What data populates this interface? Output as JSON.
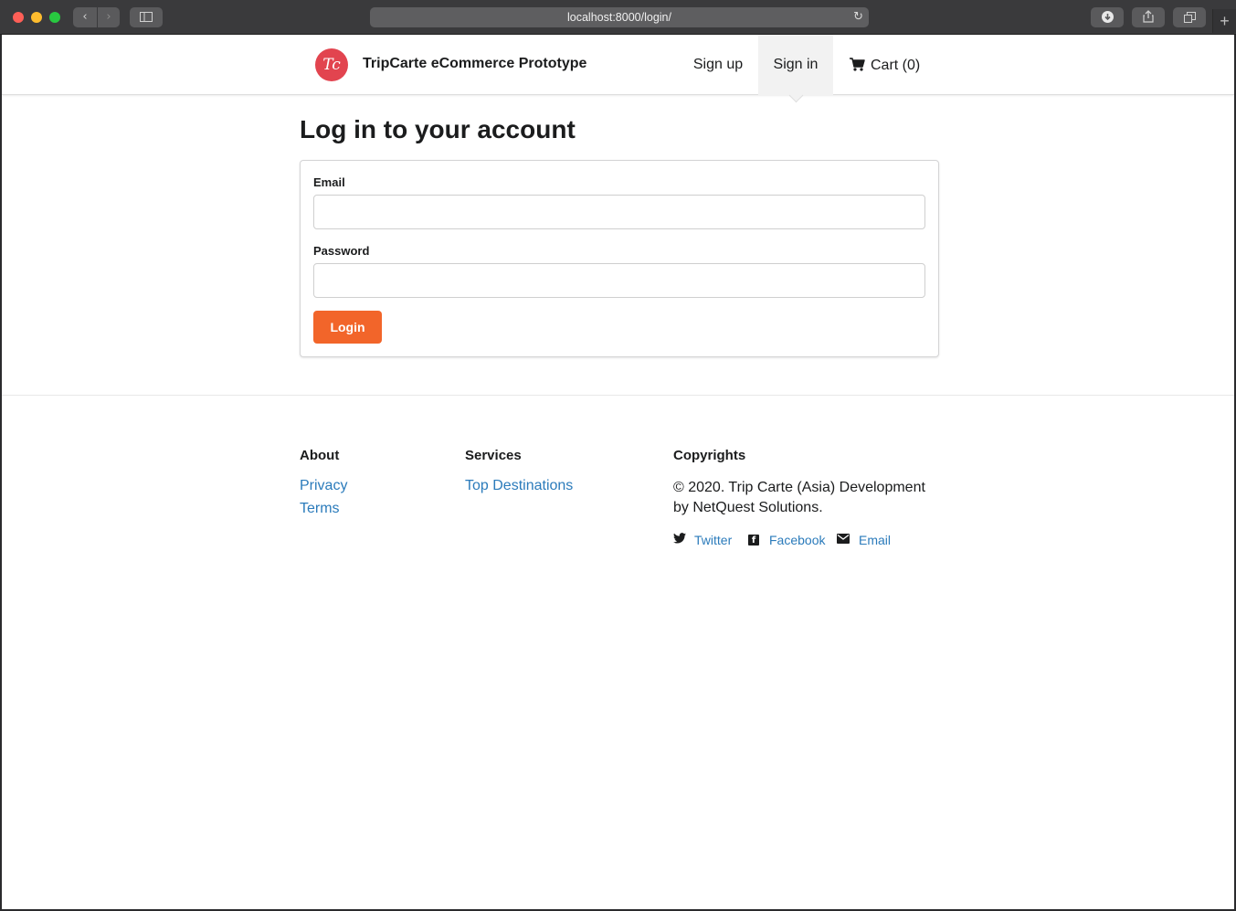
{
  "browser": {
    "url": "localhost:8000/login/",
    "icons": {
      "back": "chevron-left-icon",
      "forward": "chevron-right-icon",
      "sidebar": "sidebar-icon",
      "reload": "reload-icon",
      "download": "download-icon",
      "share": "share-icon",
      "tabs": "tabs-icon",
      "new_tab": "plus-icon"
    }
  },
  "navbar": {
    "logo_text": "Tc",
    "brand": "TripCarte eCommerce Prototype",
    "signup": "Sign up",
    "signin": "Sign in",
    "cart": "Cart (0)",
    "active_item": "signin"
  },
  "login": {
    "title": "Log in to your account",
    "email_label": "Email",
    "email_value": "",
    "password_label": "Password",
    "password_value": "",
    "submit_label": "Login"
  },
  "footer": {
    "about_heading": "About",
    "about_links": [
      "Privacy",
      "Terms"
    ],
    "services_heading": "Services",
    "services_links": [
      "Top Destinations"
    ],
    "copyrights_heading": "Copyrights",
    "copyright_text": "© 2020. Trip Carte (Asia) Development by NetQuest Solutions.",
    "social": [
      {
        "label": "Twitter",
        "icon": "twitter-icon"
      },
      {
        "label": "Facebook",
        "icon": "facebook-icon"
      },
      {
        "label": "Email",
        "icon": "envelope-icon"
      }
    ]
  },
  "colors": {
    "primary_button": "#f2652a",
    "link": "#2b7bbb",
    "logo": "#e2444f"
  }
}
